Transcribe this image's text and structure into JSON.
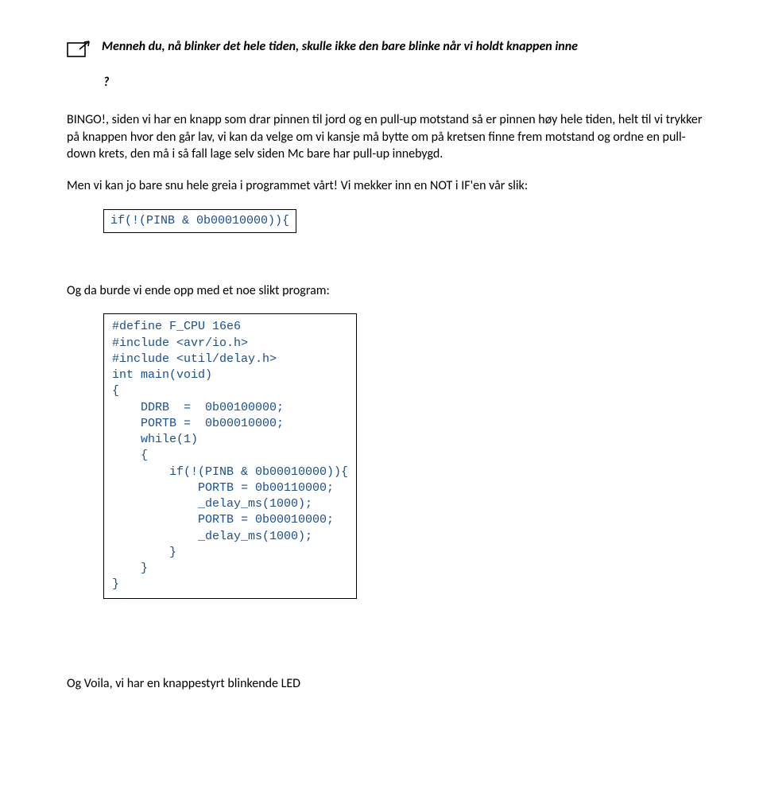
{
  "callout": {
    "text_line": "Menneh du, nå blinker det hele tiden, skulle ikke den bare blinke når vi holdt knappen inne",
    "q_line": "?"
  },
  "paragraphs": {
    "bingo": "BINGO!, siden vi har en knapp som drar pinnen til jord og en pull-up motstand så er pinnen høy hele tiden, helt til vi trykker på knappen hvor den går lav, vi kan da velge om vi kansje må bytte om på kretsen finne frem motstand og ordne en pull-down krets, den må i så fall lage selv siden Mc bare har pull-up innebygd.",
    "menvi": "Men vi kan jo bare snu hele greia i programmet vårt! Vi mekker inn en NOT i IF'en vår slik:",
    "ogda": "Og da burde vi ende opp med et noe slikt program:",
    "voila": "Og Voila, vi har en knappestyrt blinkende LED"
  },
  "code1": "if(!(PINB & 0b00010000)){",
  "code2": [
    "#define F_CPU 16e6",
    "#include <avr/io.h>",
    "#include <util/delay.h>",
    "int main(void)",
    "{",
    "    DDRB  =  0b00100000;",
    "    PORTB =  0b00010000;",
    "    while(1)",
    "    {",
    "        if(!(PINB & 0b00010000)){",
    "            PORTB = 0b00110000;",
    "            _delay_ms(1000);",
    "            PORTB = 0b00010000;",
    "            _delay_ms(1000);",
    "        }",
    "    }",
    "}"
  ]
}
